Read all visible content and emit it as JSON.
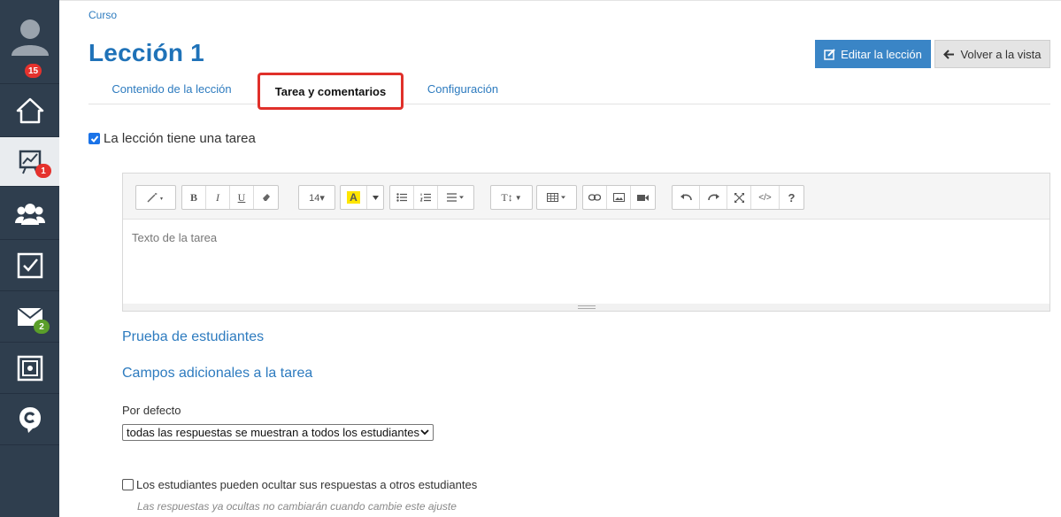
{
  "sidebar": {
    "profile_badge": "15",
    "items": [
      {
        "name": "home",
        "badge": ""
      },
      {
        "name": "courses",
        "badge": "1"
      },
      {
        "name": "groups",
        "badge": ""
      },
      {
        "name": "tasks",
        "badge": ""
      },
      {
        "name": "messages",
        "badge": "2"
      },
      {
        "name": "vault",
        "badge": ""
      },
      {
        "name": "brand",
        "badge": ""
      }
    ]
  },
  "breadcrumb": "Curso",
  "page_title": "Lección 1",
  "buttons": {
    "edit": "Editar la lección",
    "back": "Volver a la vista"
  },
  "tabs": [
    "Contenido de la lección",
    "Tarea y comentarios",
    "Configuración"
  ],
  "has_task_label": "La lección tiene una tarea",
  "toolbar": {
    "bold": "B",
    "italic": "I",
    "underline": "U",
    "font_size": "14▾",
    "highlight": "A",
    "help": "?",
    "code": "</>",
    "text_style": "T↕"
  },
  "editor": {
    "placeholder": "Texto de la tarea"
  },
  "section_student_test": "Prueba de estudiantes",
  "section_extra_fields": "Campos adicionales a la tarea",
  "default_label": "Por defecto",
  "default_select_value": "todas las respuestas se muestran a todos los estudiantes",
  "hide_answers_label": "Los estudiantes pueden ocultar sus respuestas a otros estudiantes",
  "hide_answers_note": "Las respuestas ya ocultas no cambiarán cuando cambie este ajuste",
  "colors": {
    "accent": "#1f72b8",
    "sidebar": "#2f3e4e",
    "highlight_tab": "#e0302a",
    "edit_button": "#3a85c6"
  }
}
